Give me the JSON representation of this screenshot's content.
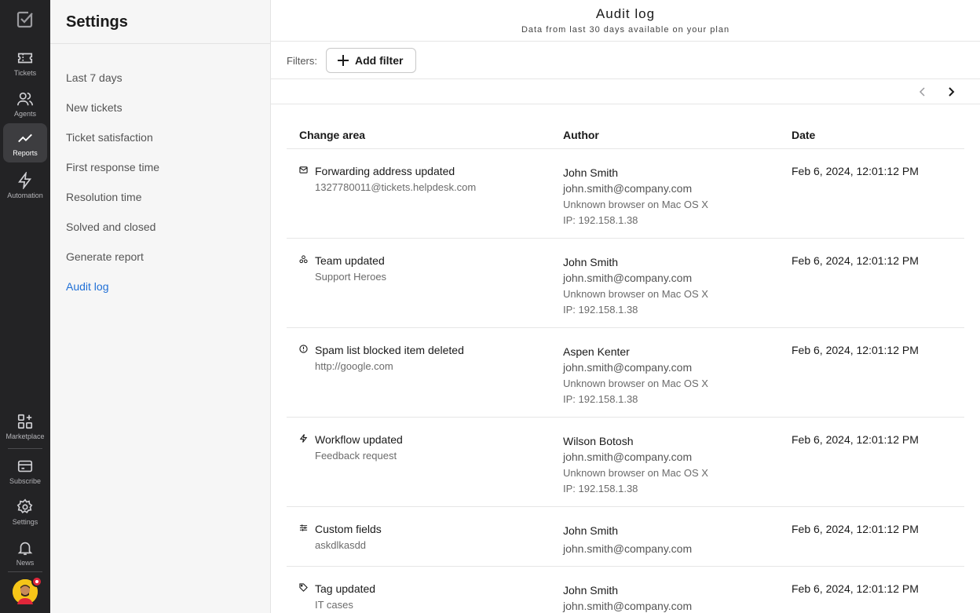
{
  "rail": {
    "items": [
      {
        "label": "Tickets",
        "icon": "ticket-icon"
      },
      {
        "label": "Agents",
        "icon": "agents-icon"
      },
      {
        "label": "Reports",
        "icon": "reports-icon",
        "active": true
      },
      {
        "label": "Automation",
        "icon": "lightning-icon"
      },
      {
        "label": "Marketplace",
        "icon": "marketplace-icon"
      },
      {
        "label": "Subscribe",
        "icon": "credit-card-icon"
      },
      {
        "label": "Settings",
        "icon": "gear-icon"
      },
      {
        "label": "News",
        "icon": "bell-icon"
      }
    ]
  },
  "sidebar": {
    "title": "Settings",
    "items": [
      {
        "label": "Last 7 days"
      },
      {
        "label": "New tickets"
      },
      {
        "label": "Ticket satisfaction"
      },
      {
        "label": "First response time"
      },
      {
        "label": "Resolution time"
      },
      {
        "label": "Solved and closed"
      },
      {
        "label": "Generate report"
      },
      {
        "label": "Audit log",
        "active": true
      }
    ]
  },
  "header": {
    "title": "Audit log",
    "subtitle": "Data from last 30 days available on your plan"
  },
  "filters": {
    "label": "Filters:",
    "add_label": "Add filter"
  },
  "table": {
    "columns": [
      "Change area",
      "Author",
      "Date"
    ],
    "rows": [
      {
        "icon": "mail-icon",
        "area": "Forwarding address updated",
        "detail": "1327780011@tickets.helpdesk.com",
        "author": "John Smith",
        "email": "john.smith@company.com",
        "browser": "Unknown browser on Mac OS X",
        "ip": "IP: 192.158.1.38",
        "date": "Feb 6, 2024, 12:01:12 PM"
      },
      {
        "icon": "team-icon",
        "area": "Team updated",
        "detail": "Support Heroes",
        "author": "John Smith",
        "email": "john.smith@company.com",
        "browser": "Unknown browser on Mac OS X",
        "ip": "IP: 192.158.1.38",
        "date": "Feb 6, 2024, 12:01:12 PM"
      },
      {
        "icon": "alert-circle-icon",
        "area": "Spam list blocked item deleted",
        "detail": "http://google.com",
        "author": "Aspen Kenter",
        "email": "john.smith@company.com",
        "browser": "Unknown browser on Mac OS X",
        "ip": "IP: 192.158.1.38",
        "date": "Feb 6, 2024, 12:01:12 PM"
      },
      {
        "icon": "lightning-icon",
        "area": "Workflow updated",
        "detail": "Feedback request",
        "author": "Wilson Botosh",
        "email": "john.smith@company.com",
        "browser": "Unknown browser on Mac OS X",
        "ip": "IP: 192.158.1.38",
        "date": "Feb 6, 2024, 12:01:12 PM"
      },
      {
        "icon": "custom-fields-icon",
        "area": "Custom fields",
        "detail": "askdlkasdd",
        "author": "John Smith",
        "email": "john.smith@company.com",
        "date": "Feb 6, 2024, 12:01:12 PM"
      },
      {
        "icon": "tag-icon",
        "area": "Tag updated",
        "detail": "IT cases",
        "author": "John Smith",
        "email": "john.smith@company.com",
        "date": "Feb 6, 2024, 12:01:12 PM"
      }
    ]
  },
  "colors": {
    "rail_bg": "#232325",
    "accent": "#1f6fd6",
    "notification": "#e0263a"
  }
}
